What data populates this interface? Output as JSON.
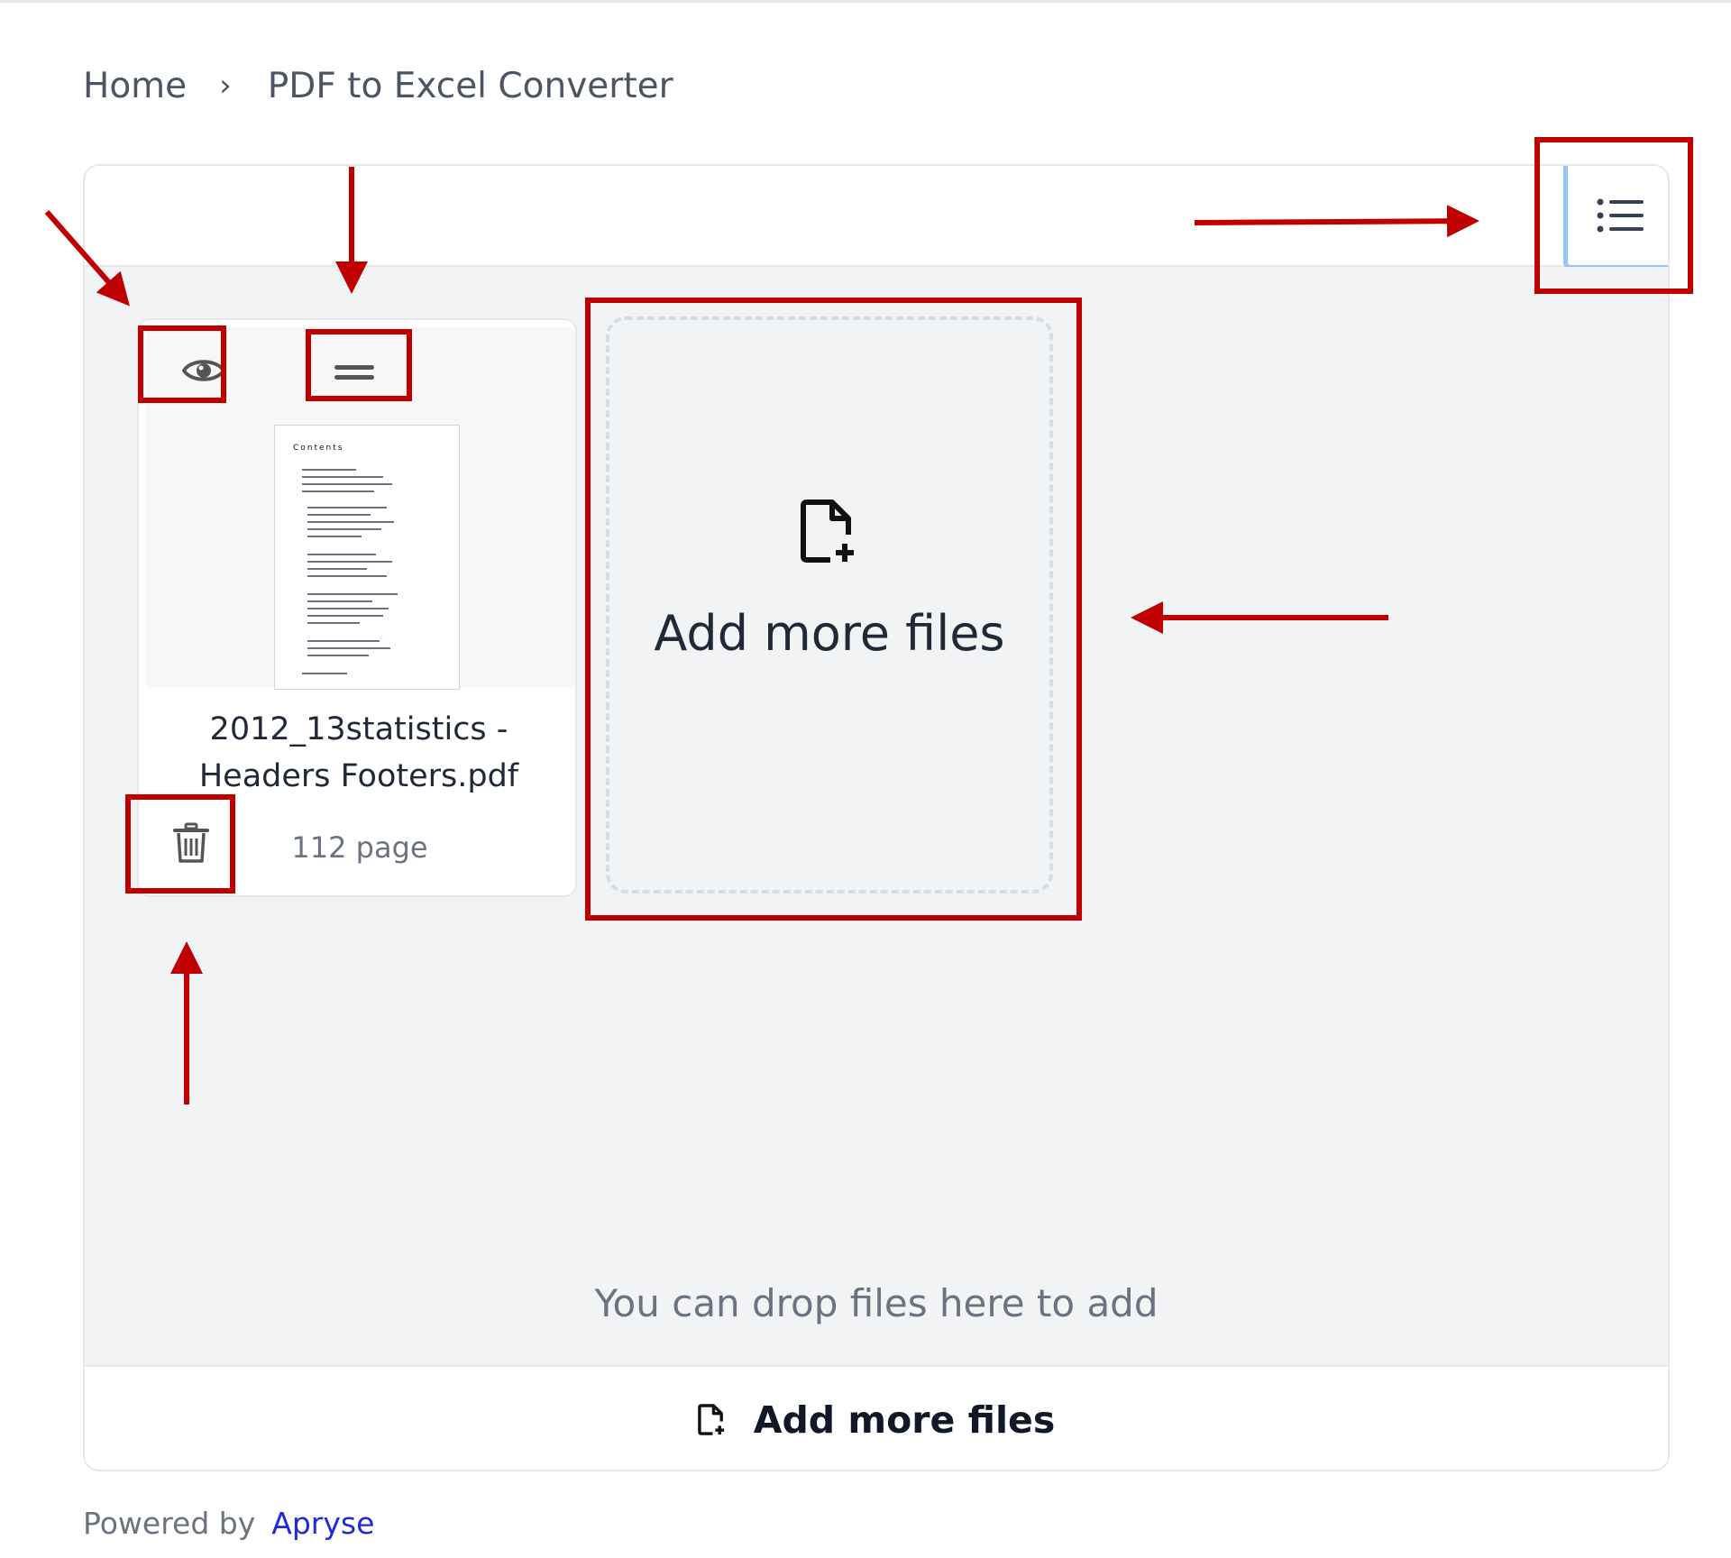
{
  "breadcrumb": {
    "home": "Home",
    "separator": "›",
    "current": "PDF to Excel Converter"
  },
  "toolbar": {
    "list_view_icon": "list-icon"
  },
  "file": {
    "name_line1": "2012_13statistics -",
    "name_line2": "Headers Footers.pdf",
    "page_count": "112 page",
    "thumbnail_title": "Contents",
    "preview_icon": "eye-icon",
    "drag_icon": "drag-handle-icon",
    "delete_icon": "trash-icon"
  },
  "add_tile": {
    "label": "Add more files",
    "icon": "file-plus-icon"
  },
  "drop_hint": "You can drop files here to add",
  "footer": {
    "label": "Add more files",
    "icon": "file-plus-icon"
  },
  "powered_by": {
    "text": "Powered by",
    "brand": "Apryse"
  },
  "colors": {
    "annotation_red": "#c00000",
    "brand_blue": "#1d2bdb",
    "drop_area_bg": "#f2f3f5",
    "selected_outline": "#93c5fd"
  }
}
